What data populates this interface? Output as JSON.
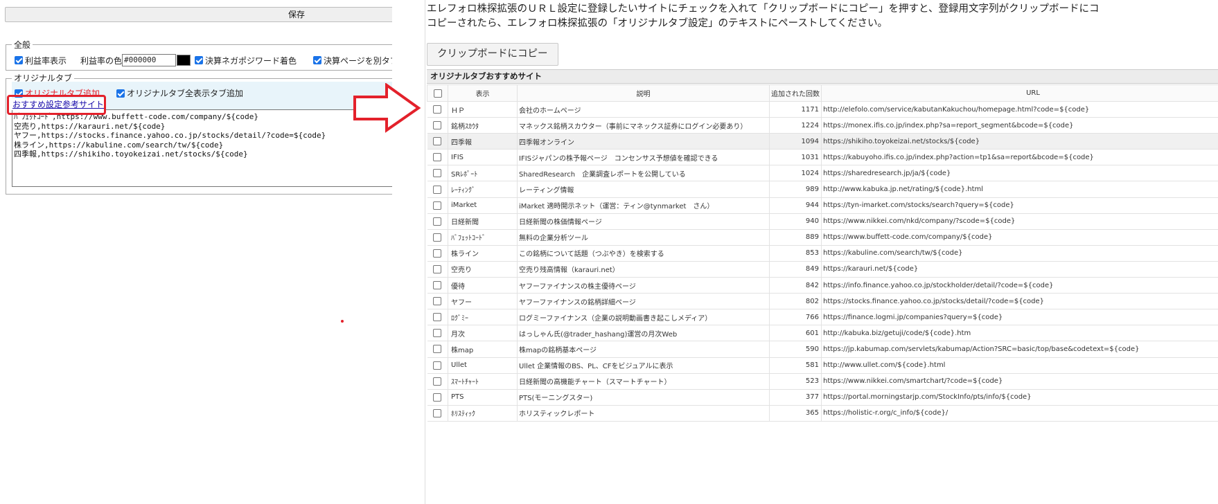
{
  "left": {
    "save_label": "保存",
    "general": {
      "legend": "全般",
      "profit_display": "利益率表示",
      "profit_color_label": "利益率の色",
      "profit_color_value": "#000000",
      "nega_posi": "決算ネガポジワード着色",
      "settle_new_tab": "決算ページを別タブで表示"
    },
    "original": {
      "legend": "オリジナルタブ",
      "add_tab": "オリジナルタブ追加",
      "all_tab": "オリジナルタブ全表示タブ追加",
      "recommend_link": "おすすめ設定参考サイト",
      "textarea_lines": "ﾊﾞﾌｪｯﾄｺｰﾄﾞ,https://www.buffett-code.com/company/${code}\n空売り,https://karauri.net/${code}\nヤフー,https://stocks.finance.yahoo.co.jp/stocks/detail/?code=${code}\n株ライン,https://kabuline.com/search/tw/${code}\n四季報,https://shikiho.toyokeizai.net/stocks/${code}"
    }
  },
  "right": {
    "instruction": "エレフォロ株探拡張のＵＲＬ設定に登録したいサイトにチェックを入れて「クリップボードにコピー」を押すと、登録用文字列がクリップボードにコピーされたら、エレフォロ株探拡張の「オリジナルタブ設定」のテキストにペーストしてください。",
    "instruction_line1": "エレフォロ株探拡張のＵＲＬ設定に登録したいサイトにチェックを入れて「クリップボードにコピー」を押すと、登録用文字列がクリップボードにコ",
    "instruction_line2": "コピーされたら、エレフォロ株探拡張の「オリジナルタブ設定」のテキストにペーストしてください。",
    "copy_button": "クリップボードにコピー",
    "section_title": "オリジナルタブおすすめサイト",
    "columns": [
      "表示",
      "説明",
      "追加された回数",
      "URL"
    ],
    "rows": [
      {
        "display": "ＨＰ",
        "desc": "会社のホームページ",
        "count": "1171",
        "url": "http://elefolo.com/service/kabutanKakuchou/homepage.html?code=${code}"
      },
      {
        "display": "銘柄ｽｶｳﾀ",
        "desc": "マネックス銘柄スカウター（事前にマネックス証券にログイン必要あり）",
        "count": "1224",
        "url": "https://monex.ifis.co.jp/index.php?sa=report_segment&bcode=${code}"
      },
      {
        "display": "四季報",
        "desc": "四季報オンライン",
        "count": "1094",
        "url": "https://shikiho.toyokeizai.net/stocks/${code}"
      },
      {
        "display": "IFIS",
        "desc": "IFISジャパンの株予報ページ　コンセンサス予想値を確認できる",
        "count": "1031",
        "url": "https://kabuyoho.ifis.co.jp/index.php?action=tp1&sa=report&bcode=${code}"
      },
      {
        "display": "SRﾚﾎﾟｰﾄ",
        "desc": "SharedResearch　企業調査レポートを公開している",
        "count": "1024",
        "url": "https://sharedresearch.jp/ja/${code}"
      },
      {
        "display": "ﾚｰﾃｨﾝｸﾞ",
        "desc": "レーティング情報",
        "count": "989",
        "url": "http://www.kabuka.jp.net/rating/${code}.html"
      },
      {
        "display": "iMarket",
        "desc": "iMarket 適時開示ネット（運営：ティン@tynmarket　さん）",
        "count": "944",
        "url": "https://tyn-imarket.com/stocks/search?query=${code}"
      },
      {
        "display": "日経新聞",
        "desc": "日経新聞の株価情報ページ",
        "count": "940",
        "url": "https://www.nikkei.com/nkd/company/?scode=${code}"
      },
      {
        "display": "ﾊﾞﾌｪｯﾄｺｰﾄﾞ",
        "desc": "無料の企業分析ツール",
        "count": "889",
        "url": "https://www.buffett-code.com/company/${code}"
      },
      {
        "display": "株ライン",
        "desc": "この銘柄について話題（つぶやき）を検索する",
        "count": "853",
        "url": "https://kabuline.com/search/tw/${code}"
      },
      {
        "display": "空売り",
        "desc": "空売り残高情報（karauri.net）",
        "count": "849",
        "url": "https://karauri.net/${code}"
      },
      {
        "display": "優待",
        "desc": "ヤフーファイナンスの株主優待ページ",
        "count": "842",
        "url": "https://info.finance.yahoo.co.jp/stockholder/detail/?code=${code}"
      },
      {
        "display": "ヤフー",
        "desc": "ヤフーファイナンスの銘柄詳細ページ",
        "count": "802",
        "url": "https://stocks.finance.yahoo.co.jp/stocks/detail/?code=${code}"
      },
      {
        "display": "ﾛｸﾞﾐｰ",
        "desc": "ログミーファイナンス（企業の説明動画書き起こしメディア）",
        "count": "766",
        "url": "https://finance.logmi.jp/companies?query=${code}"
      },
      {
        "display": "月次",
        "desc": "はっしゃん氏(@trader_hashang)運営の月次Web",
        "count": "601",
        "url": "http://kabuka.biz/getuji/code/${code}.htm"
      },
      {
        "display": "株map",
        "desc": "株mapの銘柄基本ページ",
        "count": "590",
        "url": "https://jp.kabumap.com/servlets/kabumap/Action?SRC=basic/top/base&codetext=${code}"
      },
      {
        "display": "Ullet",
        "desc": "Ullet 企業情報のBS、PL、CFをビジュアルに表示",
        "count": "581",
        "url": "http://www.ullet.com/${code}.html"
      },
      {
        "display": "ｽﾏｰﾄﾁｬｰﾄ",
        "desc": "日経新聞の高機能チャート（スマートチャート）",
        "count": "523",
        "url": "https://www.nikkei.com/smartchart/?code=${code}"
      },
      {
        "display": "PTS",
        "desc": "PTS(モーニングスター)",
        "count": "377",
        "url": "https://portal.morningstarjp.com/StockInfo/pts/info/${code}"
      },
      {
        "display": "ﾎﾘｽﾃｨｯｸ",
        "desc": "ホリスティックレポート",
        "count": "365",
        "url": "https://holistic-r.org/c_info/${code}/"
      }
    ]
  },
  "colors": {
    "annotation_red": "#e3212b",
    "checkbox_blue": "#1a73e8",
    "link": "#1a0dab"
  }
}
